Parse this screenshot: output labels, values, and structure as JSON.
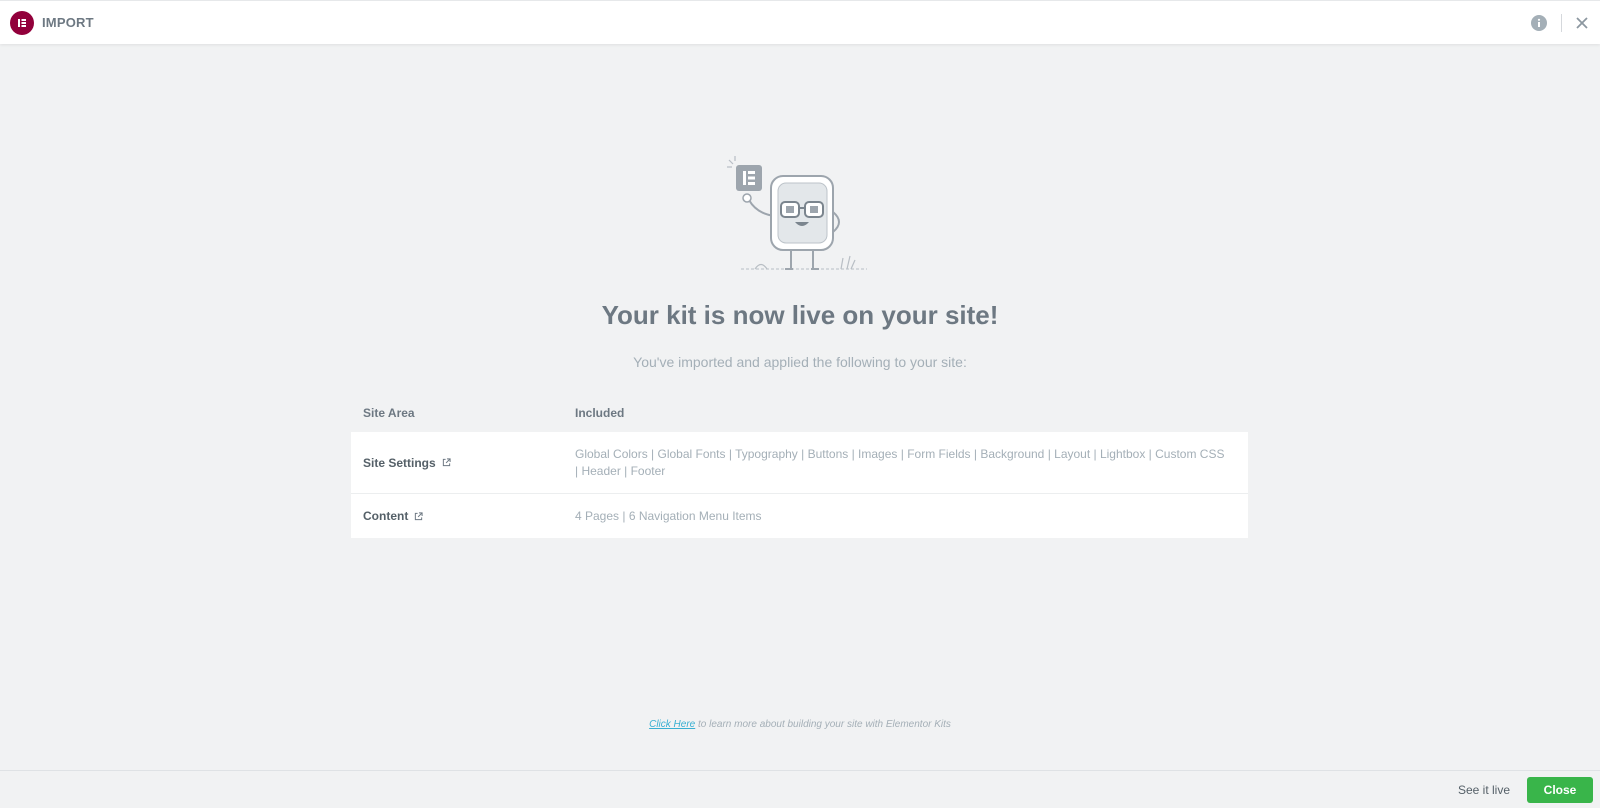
{
  "header": {
    "title": "IMPORT",
    "logo_icon": "elementor-logo-icon",
    "brand_color": "#92003b",
    "info_icon": "info-icon",
    "close_icon": "close-icon"
  },
  "main": {
    "illustration_icon": "elementor-mascot-illustration",
    "title": "Your kit is now live on your site!",
    "subtitle": "You've imported and applied the following to your site:"
  },
  "summary_table": {
    "columns": [
      "Site Area",
      "Included"
    ],
    "rows": [
      {
        "area": "Site Settings",
        "icon": "external-link-icon",
        "included": "Global Colors | Global Fonts | Typography | Buttons | Images | Form Fields | Background | Layout | Lightbox | Custom CSS | Header | Footer"
      },
      {
        "area": "Content",
        "icon": "external-link-icon",
        "included": "4 Pages | 6 Navigation Menu Items"
      }
    ]
  },
  "footer_note": {
    "link_text": "Click Here",
    "text": "to learn more about building your site with Elementor Kits",
    "link_color": "#39b0d2"
  },
  "actions": {
    "see_live_label": "See it live",
    "close_label": "Close",
    "close_color": "#39b54a"
  }
}
